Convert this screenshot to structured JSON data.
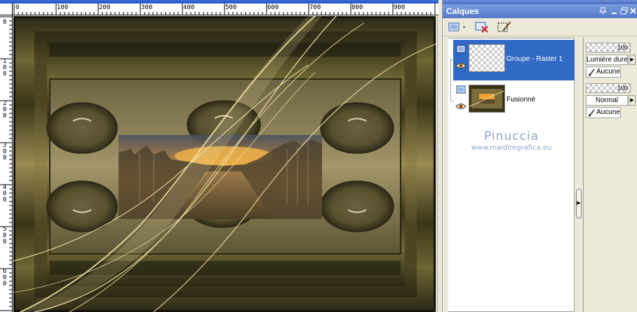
{
  "ruler_top": {
    "ticks": [
      "0",
      "100",
      "200",
      "300",
      "400",
      "500",
      "600",
      "700",
      "800",
      "900"
    ]
  },
  "ruler_left": {
    "ticks": [
      "0",
      "100",
      "200",
      "300",
      "400",
      "500",
      "600"
    ]
  },
  "panel": {
    "title": "Calques",
    "pin_icon": "pin-icon",
    "minimize_icon": "minimize-icon",
    "restore_icon": "restore-icon",
    "close_icon": "close-icon"
  },
  "toolbar": {
    "new_layer_icon": "new-layer-icon",
    "delete_layer_icon": "delete-layer-icon",
    "edit_mask_icon": "edit-mask-icon"
  },
  "layers": [
    {
      "name": "Groupe - Raster 1",
      "opacity": "100",
      "blend": "Lumière dure",
      "mask": "Aucune",
      "selected": true
    },
    {
      "name": "Fusionné",
      "opacity": "100",
      "blend": "Normal",
      "mask": "Aucune",
      "selected": false
    }
  ],
  "watermark": {
    "name": "Pinuccia",
    "url": "www.maidiregrafica.eu"
  },
  "colors": {
    "selection": "#316ac5",
    "panel_bg": "#ece9d8",
    "canvas_frame": "#5a532a",
    "sunset": "#f0a030"
  }
}
